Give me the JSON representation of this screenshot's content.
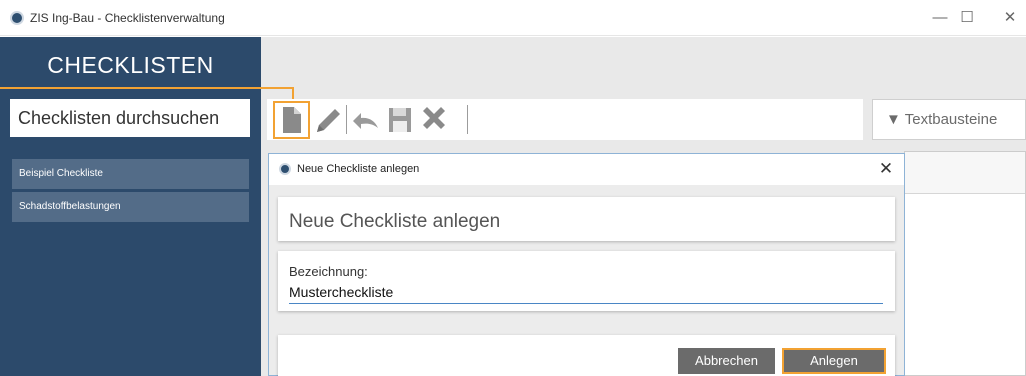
{
  "window": {
    "title": "ZIS Ing-Bau - Checklistenverwaltung",
    "controls": {
      "minimize": "—",
      "maximize": "☐",
      "close": "✕"
    }
  },
  "sidebar": {
    "title": "CHECKLISTEN",
    "search_label": "Checklisten durchsuchen",
    "items": [
      {
        "label": "Beispiel Checkliste"
      },
      {
        "label": "Schadstoffbelastungen"
      }
    ]
  },
  "toolbar": {
    "buttons": [
      {
        "icon": "new-document-icon",
        "highlighted": true
      },
      {
        "icon": "pencil-icon"
      },
      {
        "icon": "undo-icon"
      },
      {
        "icon": "save-icon"
      },
      {
        "icon": "delete-icon"
      }
    ],
    "textbausteine_label": "▼ Textbausteine"
  },
  "dialog": {
    "title": "Neue Checkliste anlegen",
    "close": "✕",
    "heading": "Neue Checkliste anlegen",
    "field_label": "Bezeichnung:",
    "field_value": "Mustercheckliste",
    "cancel_label": "Abbrechen",
    "create_label": "Anlegen"
  },
  "colors": {
    "sidebar": "#2c4a6b",
    "sidebar_item": "#536c88",
    "accent": "#f2a233",
    "button": "#6b6b6b",
    "icon_gray": "#8a8a8a"
  }
}
